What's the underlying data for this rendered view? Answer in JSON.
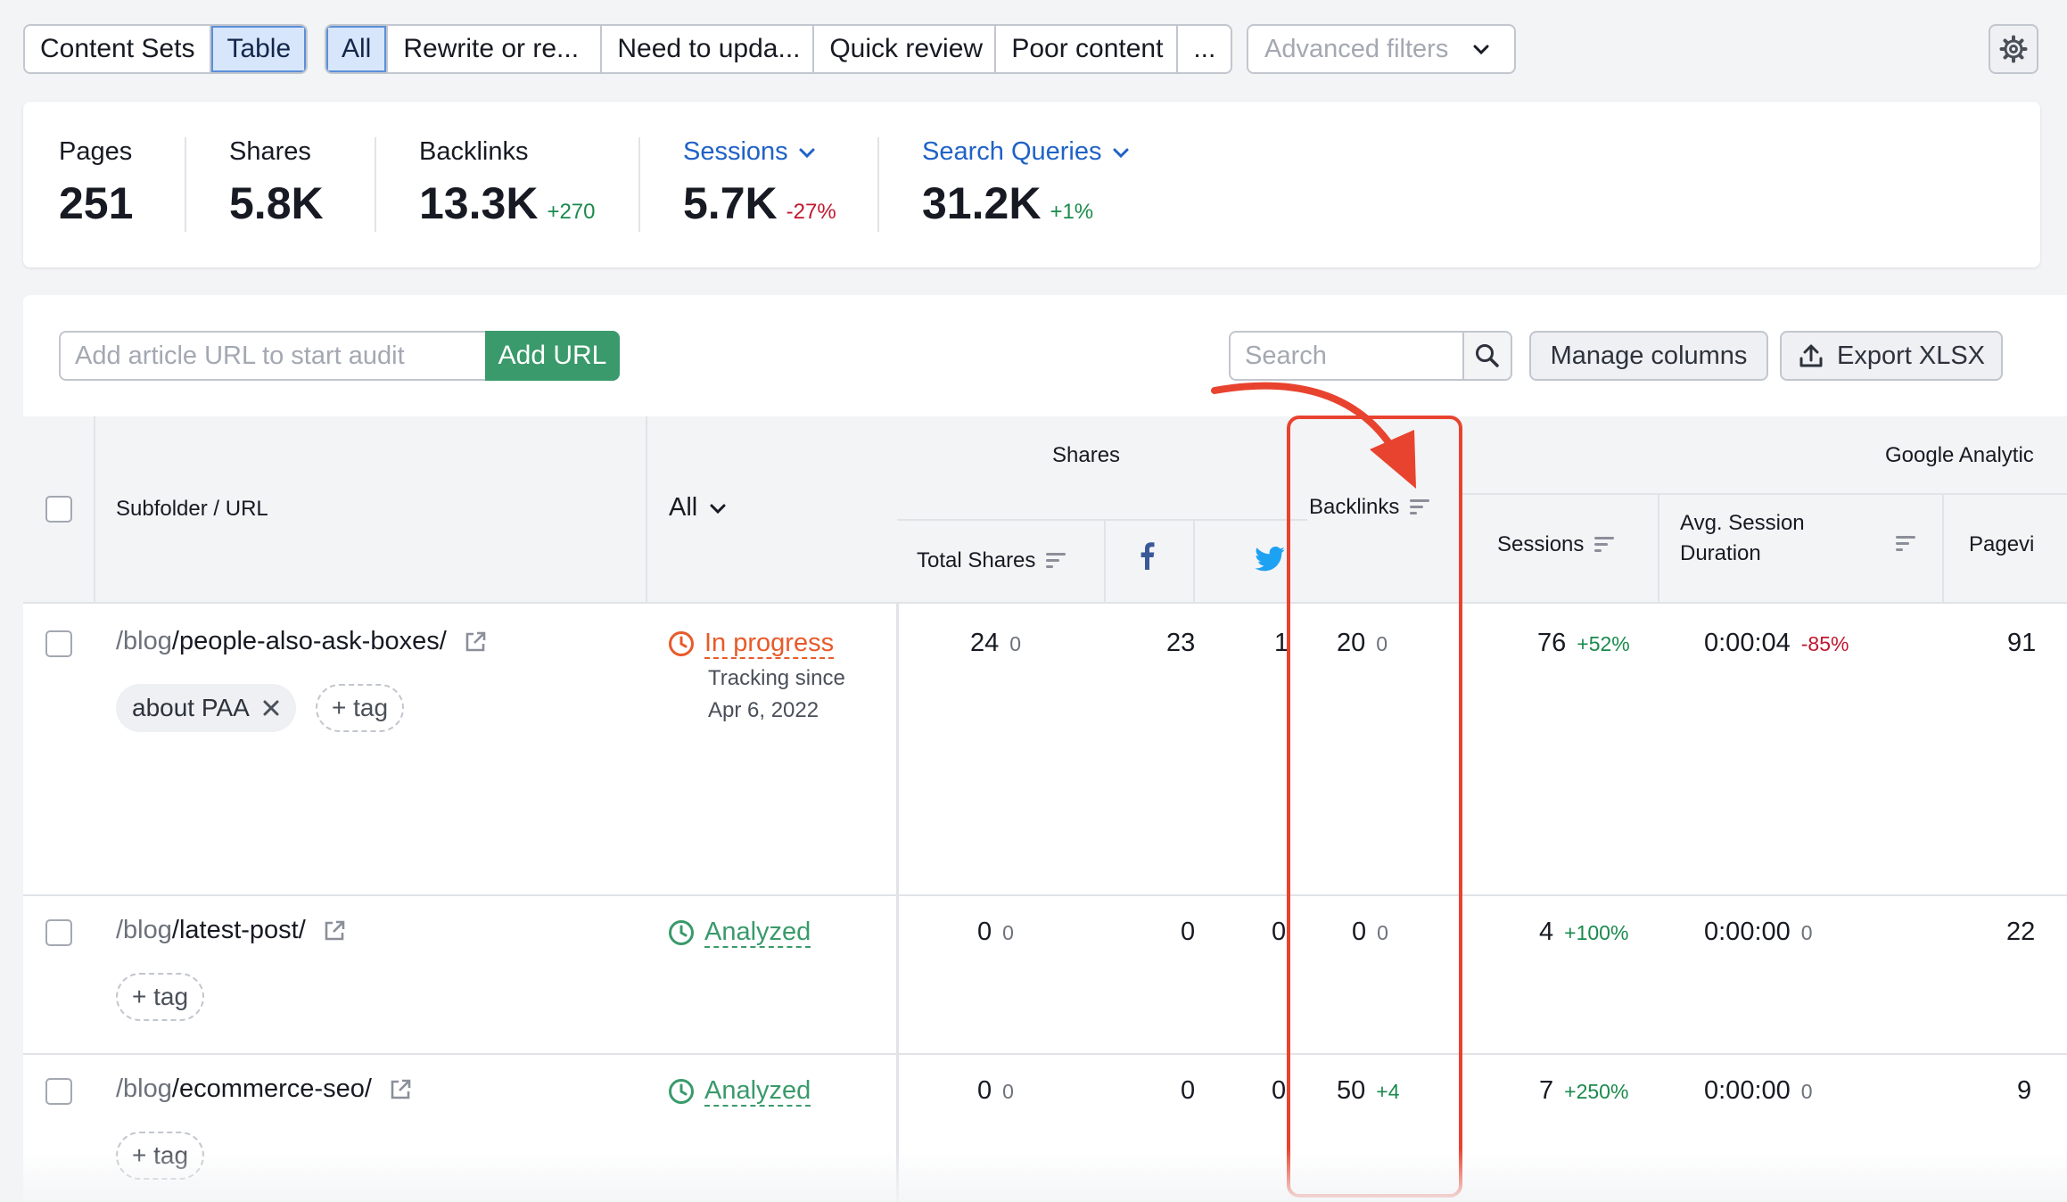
{
  "toolbar": {
    "view_tabs": [
      "Content Sets",
      "Table"
    ],
    "filter_tabs": [
      "All",
      "Rewrite or re...",
      "Need to upda...",
      "Quick review",
      "Poor content",
      "..."
    ],
    "advanced_filters": "Advanced filters"
  },
  "summary": {
    "pages": {
      "label": "Pages",
      "value": "251"
    },
    "shares": {
      "label": "Shares",
      "value": "5.8K"
    },
    "backlinks": {
      "label": "Backlinks",
      "value": "13.3K",
      "delta": "+270"
    },
    "sessions": {
      "label": "Sessions",
      "value": "5.7K",
      "delta": "-27%"
    },
    "search_queries": {
      "label": "Search Queries",
      "value": "31.2K",
      "delta": "+1%"
    }
  },
  "actions": {
    "url_placeholder": "Add article URL to start audit",
    "add_url": "Add URL",
    "search_placeholder": "Search",
    "manage_columns": "Manage columns",
    "export": "Export XLSX"
  },
  "table": {
    "headers": {
      "url": "Subfolder / URL",
      "status_filter": "All",
      "shares_group": "Shares",
      "total_shares": "Total Shares",
      "backlinks": "Backlinks",
      "ga_group": "Google Analytic",
      "sessions": "Sessions",
      "avg_session_line1": "Avg. Session",
      "avg_session_line2": "Duration",
      "pageviews": "Pagevi"
    },
    "rows": [
      {
        "folder": "/blog",
        "slug": "/people-also-ask-boxes/",
        "tag": "about PAA",
        "add_tag": "+ tag",
        "status": "In progress",
        "tracking_line1": "Tracking since",
        "tracking_line2": "Apr 6, 2022",
        "total_shares": "24",
        "total_shares_delta": "0",
        "facebook": "23",
        "twitter": "1",
        "backlinks": "20",
        "backlinks_delta": "0",
        "sessions": "76",
        "sessions_delta": "+52%",
        "avg_duration": "0:00:04",
        "avg_duration_delta": "-85%",
        "pageviews": "91"
      },
      {
        "folder": "/blog",
        "slug": "/latest-post/",
        "add_tag": "+ tag",
        "status": "Analyzed",
        "total_shares": "0",
        "total_shares_delta": "0",
        "facebook": "0",
        "twitter": "0",
        "backlinks": "0",
        "backlinks_delta": "0",
        "sessions": "4",
        "sessions_delta": "+100%",
        "avg_duration": "0:00:00",
        "avg_duration_delta": "0",
        "pageviews": "22"
      },
      {
        "folder": "/blog",
        "slug": "/ecommerce-seo/",
        "add_tag": "+ tag",
        "status": "Analyzed",
        "total_shares": "0",
        "total_shares_delta": "0",
        "facebook": "0",
        "twitter": "0",
        "backlinks": "50",
        "backlinks_delta": "+4",
        "sessions": "7",
        "sessions_delta": "+250%",
        "avg_duration": "0:00:00",
        "avg_duration_delta": "0",
        "pageviews": "9"
      }
    ]
  },
  "colors": {
    "accent_green": "#3a9a6b",
    "link_blue": "#1f62c7",
    "in_progress": "#e85a2a",
    "highlight_red": "#e8432f",
    "facebook": "#3b5998",
    "twitter": "#1da1f2"
  },
  "icons": [
    "chevron-down-icon",
    "gear-icon",
    "search-icon",
    "export-icon",
    "sort-icon",
    "facebook-icon",
    "twitter-icon",
    "external-link-icon",
    "close-icon",
    "clock-icon",
    "arrow-annotation"
  ]
}
